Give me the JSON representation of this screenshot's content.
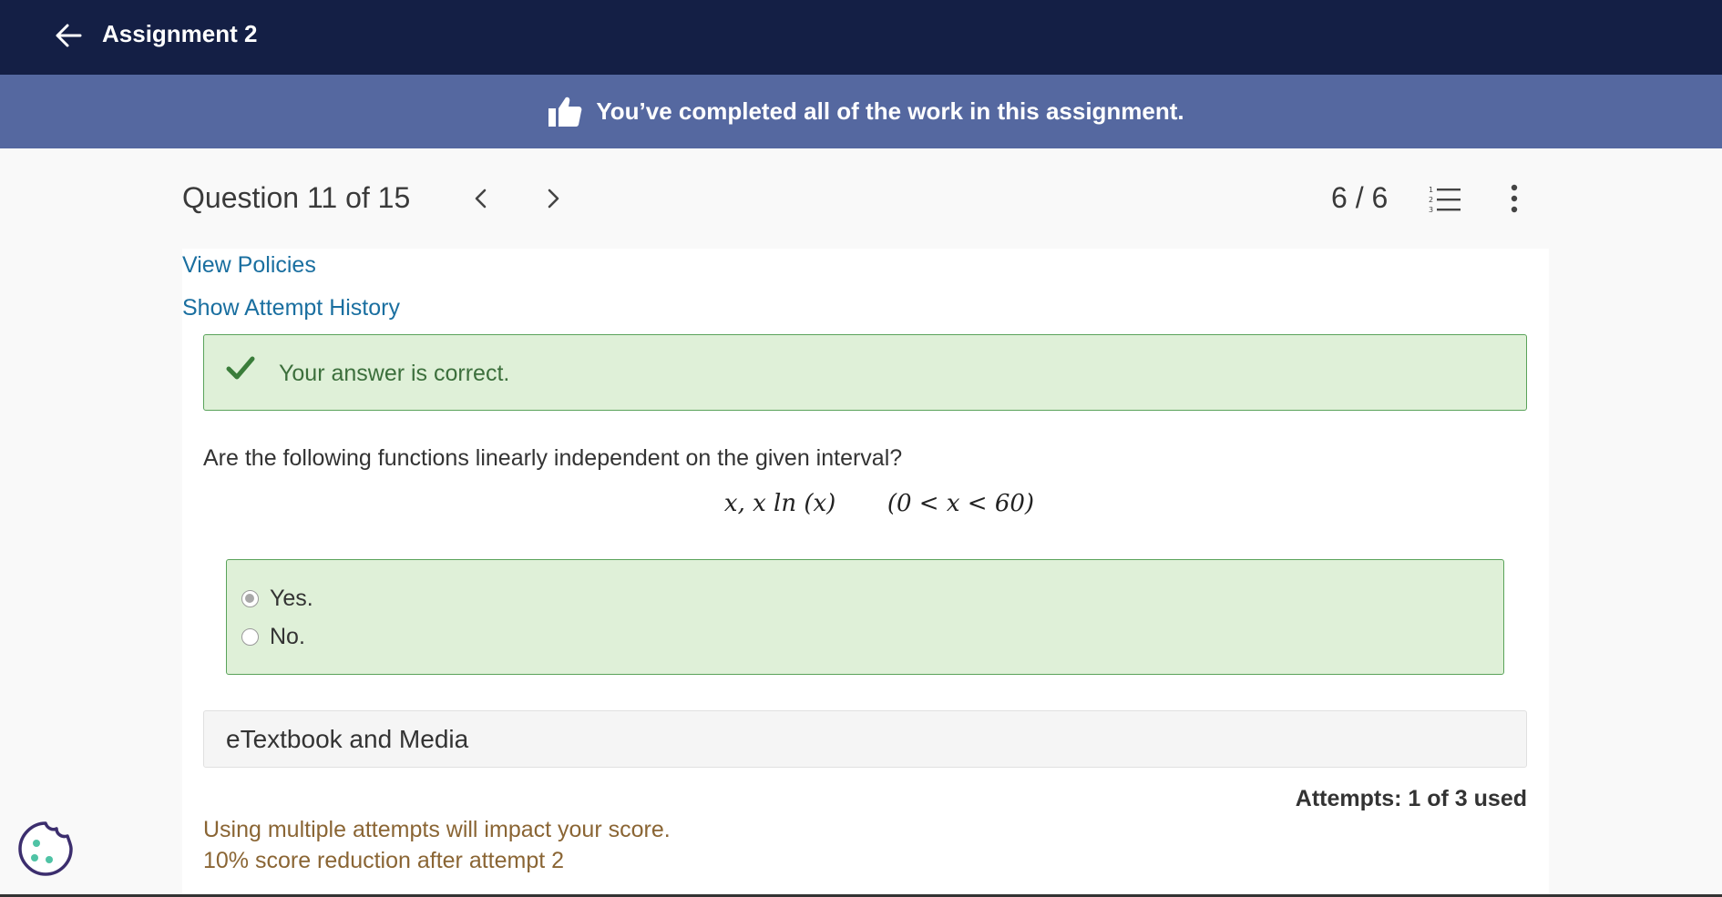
{
  "header": {
    "title": "Assignment 2",
    "back_icon": "arrow-left-icon",
    "bg_color": "#141f45"
  },
  "banner": {
    "text": "You’ve completed all of the work in this assignment.",
    "icon": "thumbs-up-icon",
    "bg_color": "#5568a0"
  },
  "question_nav": {
    "title": "Question 11 of 15",
    "prev_icon": "chevron-left-icon",
    "next_icon": "chevron-right-icon",
    "score": "6 / 6",
    "list_icon": "numbered-list-icon",
    "more_icon": "kebab-menu-icon"
  },
  "links": {
    "view_policies": "View Policies",
    "show_attempt_history": "Show Attempt History"
  },
  "feedback": {
    "text": "Your answer is correct.",
    "icon": "checkmark-icon",
    "color": "#dff0d8"
  },
  "question": {
    "prompt": "Are the following functions linearly independent on the given interval?",
    "math_functions": "x,  x ln (x)",
    "math_interval": "(0 < x < 60)"
  },
  "answer_options": [
    {
      "label": "Yes.",
      "selected": true
    },
    {
      "label": "No.",
      "selected": false
    }
  ],
  "etextbook": {
    "label": "eTextbook and Media"
  },
  "attempts": {
    "text": "Attempts: 1 of 3 used"
  },
  "policy_notes": {
    "line1": "Using multiple attempts will impact your score.",
    "line2": "10% score reduction after attempt 2"
  },
  "cookie_icon": "cookie-icon"
}
